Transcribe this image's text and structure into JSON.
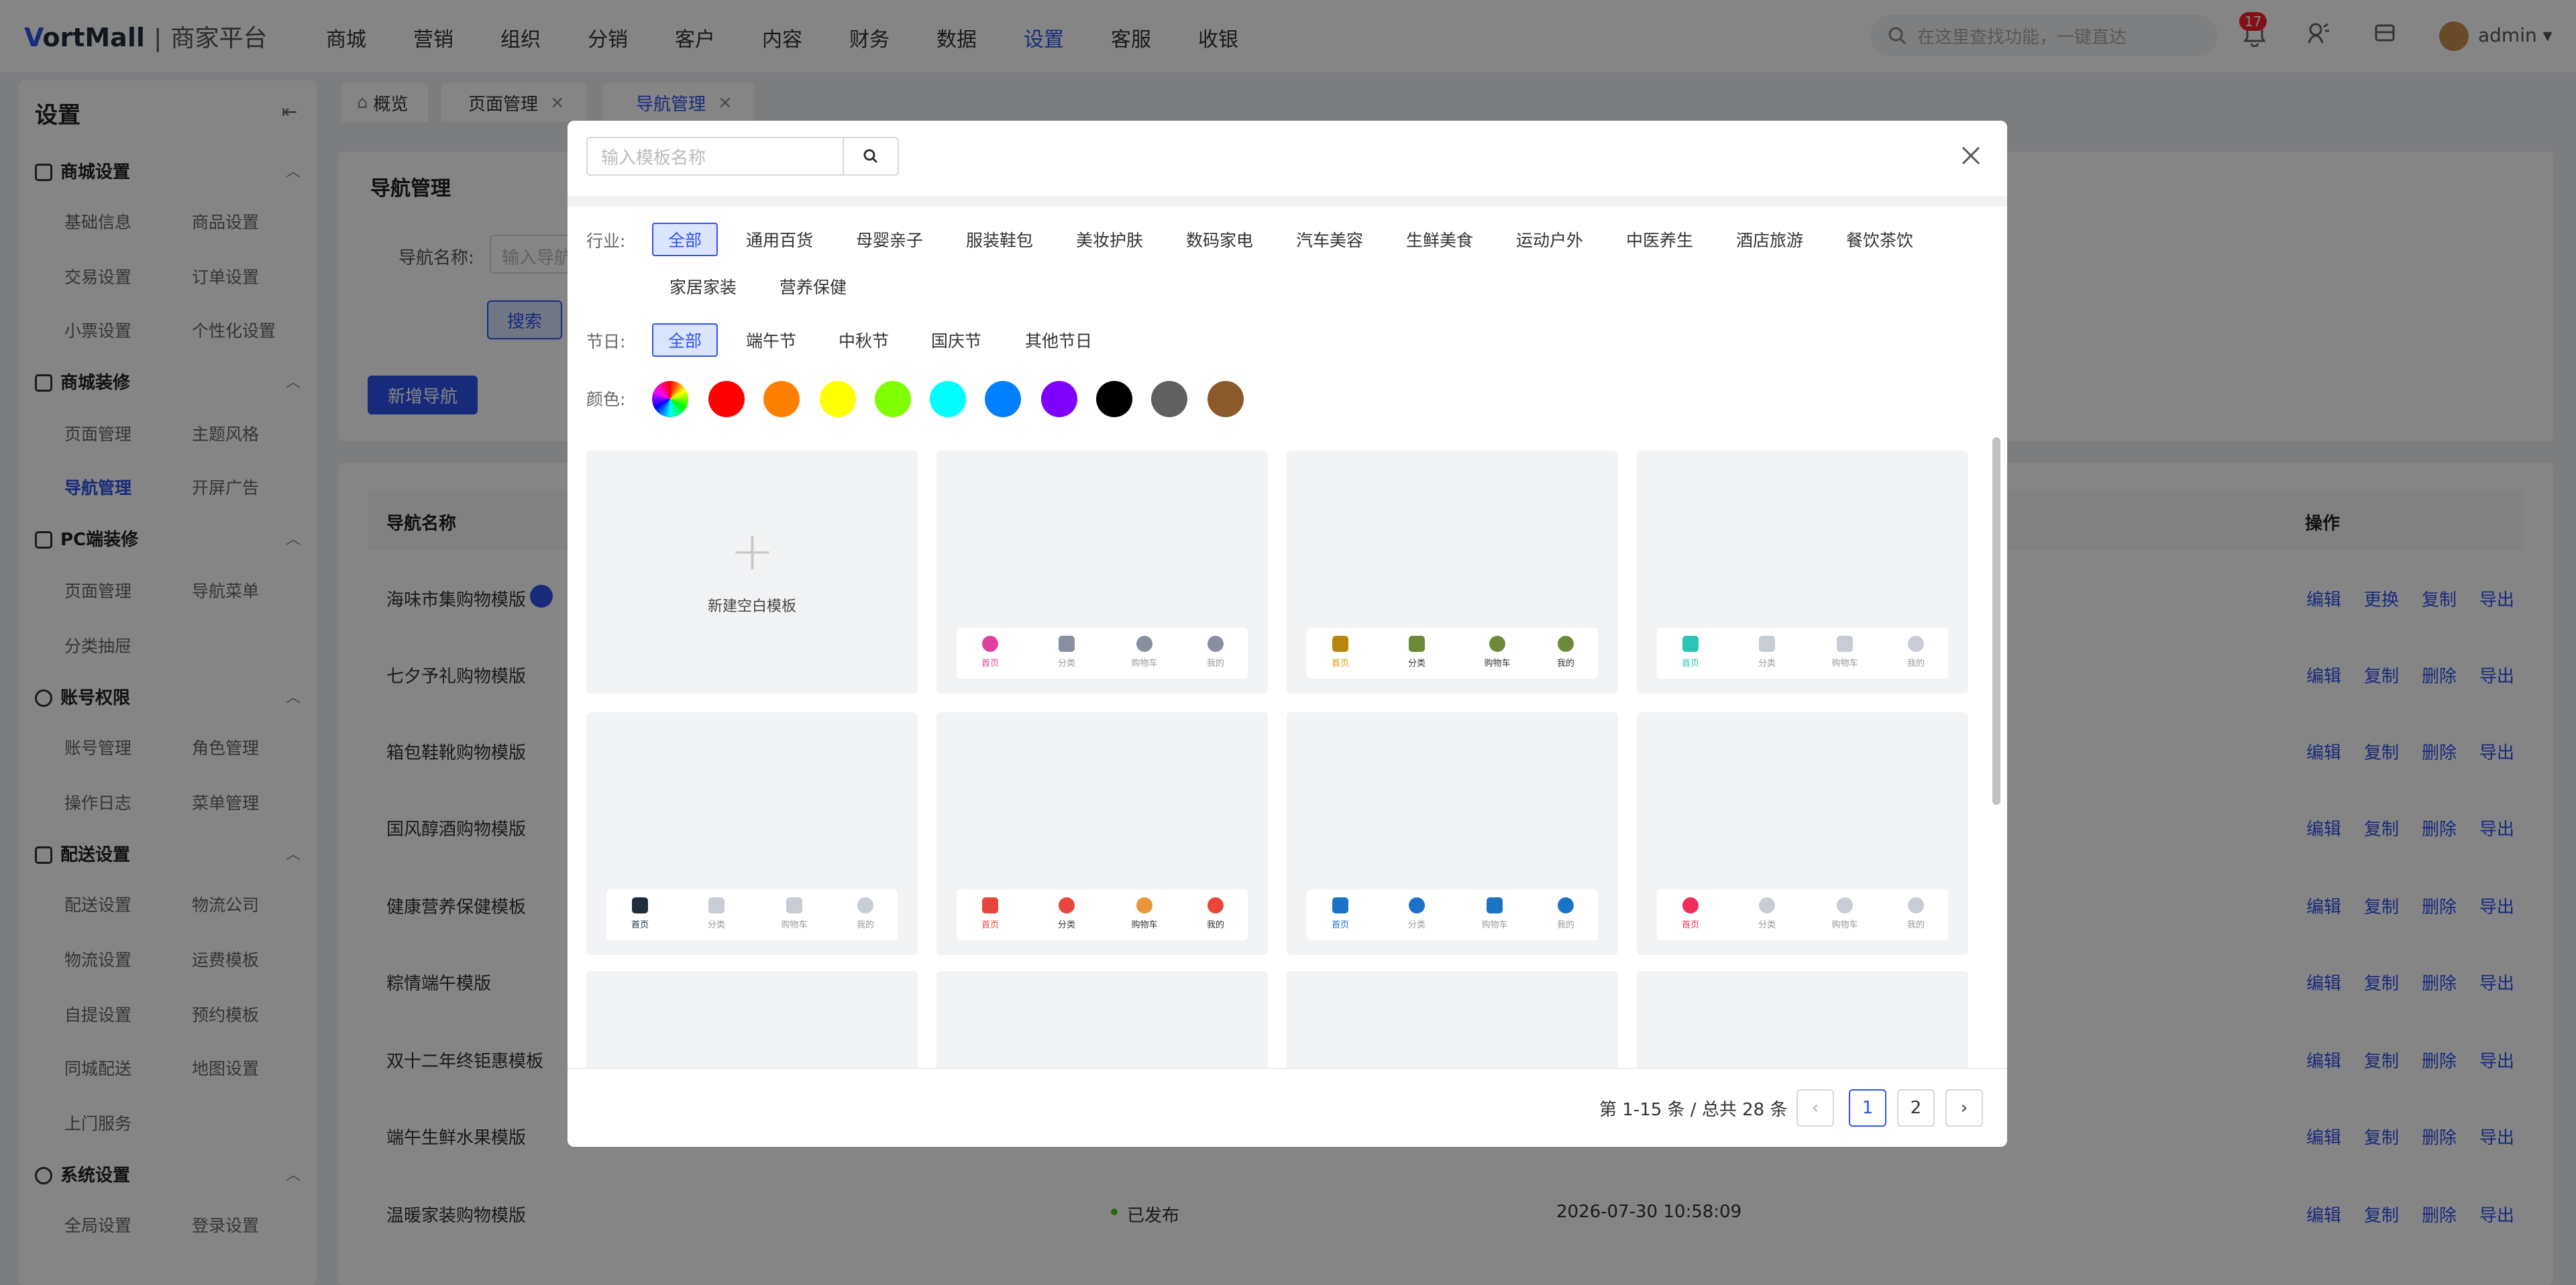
{
  "header": {
    "logo_mark": "V",
    "logo_text": "ortMall",
    "logo_sep": "|",
    "logo_sub": "商家平台",
    "nav": [
      "商城",
      "营销",
      "组织",
      "分销",
      "客户",
      "内容",
      "财务",
      "数据",
      "设置",
      "客服",
      "收银"
    ],
    "active_nav": "设置",
    "search_placeholder": "在这里查找功能，一键直达",
    "notify_count": "17",
    "user": "admin"
  },
  "sidebar": {
    "title": "设置",
    "groups": [
      {
        "label": "商城设置",
        "items": [
          "基础信息",
          "商品设置",
          "交易设置",
          "订单设置",
          "小票设置",
          "个性化设置"
        ]
      },
      {
        "label": "商城装修",
        "items": [
          "页面管理",
          "主题风格",
          "导航管理",
          "开屏广告"
        ]
      },
      {
        "label": "PC端装修",
        "items": [
          "页面管理",
          "导航菜单",
          "分类抽屉"
        ]
      },
      {
        "label": "账号权限",
        "items": [
          "账号管理",
          "角色管理",
          "操作日志",
          "菜单管理"
        ]
      },
      {
        "label": "配送设置",
        "items": [
          "配送设置",
          "物流公司",
          "物流设置",
          "运费模板",
          "自提设置",
          "预约模板",
          "同城配送",
          "地图设置",
          "上门服务"
        ]
      },
      {
        "label": "系统设置",
        "items": [
          "全局设置",
          "登录设置"
        ]
      }
    ],
    "active_item": "导航管理"
  },
  "tabs": [
    {
      "label": "概览"
    },
    {
      "label": "页面管理",
      "close": "×"
    },
    {
      "label": "导航管理",
      "close": "×"
    }
  ],
  "page": {
    "title": "导航管理",
    "filter_label": "导航名称:",
    "filter_placeholder": "输入导航名称",
    "search_btn": "搜索",
    "add_btn": "新增导航",
    "table_headers": {
      "name": "导航名称",
      "ops": "操作"
    },
    "rows": [
      {
        "name": "海味市集购物模版",
        "actions": [
          "编辑",
          "更换",
          "复制",
          "导出"
        ]
      },
      {
        "name": "七夕予礼购物模版",
        "actions": [
          "编辑",
          "复制",
          "删除",
          "导出"
        ]
      },
      {
        "name": "箱包鞋靴购物模版",
        "actions": [
          "编辑",
          "复制",
          "删除",
          "导出"
        ]
      },
      {
        "name": "国风醇酒购物模版",
        "actions": [
          "编辑",
          "复制",
          "删除",
          "导出"
        ]
      },
      {
        "name": "健康营养保健模板",
        "actions": [
          "编辑",
          "复制",
          "删除",
          "导出"
        ]
      },
      {
        "name": "粽情端午模版",
        "actions": [
          "编辑",
          "复制",
          "删除",
          "导出"
        ]
      },
      {
        "name": "双十二年终钜惠模板",
        "actions": [
          "编辑",
          "复制",
          "删除",
          "导出"
        ]
      },
      {
        "name": "端午生鲜水果模版",
        "actions": [
          "编辑",
          "复制",
          "删除",
          "导出"
        ]
      },
      {
        "name": "温暖家装购物模版",
        "status": "已发布",
        "time": "2026-07-30 10:58:09",
        "actions": [
          "编辑",
          "复制",
          "删除",
          "导出"
        ]
      }
    ]
  },
  "modal": {
    "search_placeholder": "输入模板名称",
    "industry_label": "行业:",
    "industries": [
      "全部",
      "通用百货",
      "母婴亲子",
      "服装鞋包",
      "美妆护肤",
      "数码家电",
      "汽车美容",
      "生鲜美食",
      "运动户外",
      "中医养生",
      "酒店旅游",
      "餐饮茶饮",
      "家居家装",
      "营养保健"
    ],
    "holiday_label": "节日:",
    "holidays": [
      "全部",
      "端午节",
      "中秋节",
      "国庆节",
      "其他节日"
    ],
    "color_label": "颜色:",
    "colors": [
      "#ff0000",
      "#ff8000",
      "#ffff00",
      "#80ff00",
      "#00ffff",
      "#0080ff",
      "#8000ff",
      "#000000",
      "#606060",
      "#8b5a2b"
    ],
    "new_blank": "新建空白模板",
    "nav_labels": [
      "首页",
      "分类",
      "购物车",
      "我的"
    ],
    "template_colors": [
      "#e040a0",
      "#b8860b",
      "#2bc4b4",
      "#1f2d3d",
      "#e8453c",
      "#1a73c8",
      "#ef2f5a"
    ],
    "pagination": {
      "total": "第 1-15 条 / 总共 28 条",
      "pages": [
        "1",
        "2"
      ],
      "current": "1"
    }
  }
}
